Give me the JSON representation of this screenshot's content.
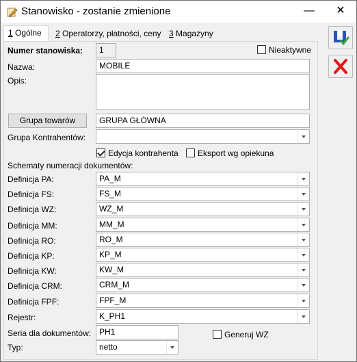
{
  "window": {
    "title": "Stanowisko - zostanie zmienione",
    "minimize_glyph": "—",
    "close_glyph": "✕"
  },
  "tabs": [
    {
      "accel": "1",
      "label": " Ogólne",
      "active": true
    },
    {
      "accel": "2",
      "label": " Operatorzy, płatności, ceny",
      "active": false
    },
    {
      "accel": "3",
      "label": " Magazyny",
      "active": false
    }
  ],
  "form": {
    "numer_label": "Numer stanowiska:",
    "numer_value": "1",
    "nieaktywne_label": "Nieaktywne",
    "nieaktywne_checked": false,
    "nazwa_label": "Nazwa:",
    "nazwa_value": "MOBILE",
    "opis_label": "Opis:",
    "opis_value": "",
    "grupa_towarow_button": "Grupa towarów",
    "grupa_towarow_value": "GRUPA GŁÓWNA",
    "grupa_kontrahentow_label": "Grupa Kontrahentów:",
    "grupa_kontrahentow_value": "",
    "edycja_kontrahenta_label": "Edycja kontrahenta",
    "edycja_kontrahenta_checked": true,
    "eksport_label": "Eksport wg opiekuna",
    "eksport_checked": false,
    "schematy_label": "Schematy numeracji dokumentów:",
    "definitions": [
      {
        "label": "Definicja PA:",
        "value": "PA_M"
      },
      {
        "label": "Definicja FS:",
        "value": "FS_M"
      },
      {
        "label": "Definicja WZ:",
        "value": "WZ_M"
      },
      {
        "label": "Definicja MM:",
        "value": "MM_M"
      },
      {
        "label": "Definicja RO:",
        "value": "RO_M"
      },
      {
        "label": "Definicja KP:",
        "value": "KP_M"
      },
      {
        "label": "Definicja KW:",
        "value": "KW_M"
      },
      {
        "label": "Definicja CRM:",
        "value": "CRM_M"
      },
      {
        "label": "Definicja FPF:",
        "value": "FPF_M"
      }
    ],
    "rejestr_label": "Rejestr:",
    "rejestr_value": "K_PH1",
    "seria_label": "Seria dla dokumentów:",
    "seria_value": "PH1",
    "generuj_wz_label": "Generuj WZ",
    "generuj_wz_checked": false,
    "typ_label": "Typ:",
    "typ_value": "netto"
  },
  "side_buttons": [
    {
      "icon": "save-icon"
    },
    {
      "icon": "cancel-icon"
    }
  ],
  "colors": {
    "save_blue": "#2a55b8",
    "save_check": "#3aa83a",
    "cancel_red": "#e01818"
  }
}
